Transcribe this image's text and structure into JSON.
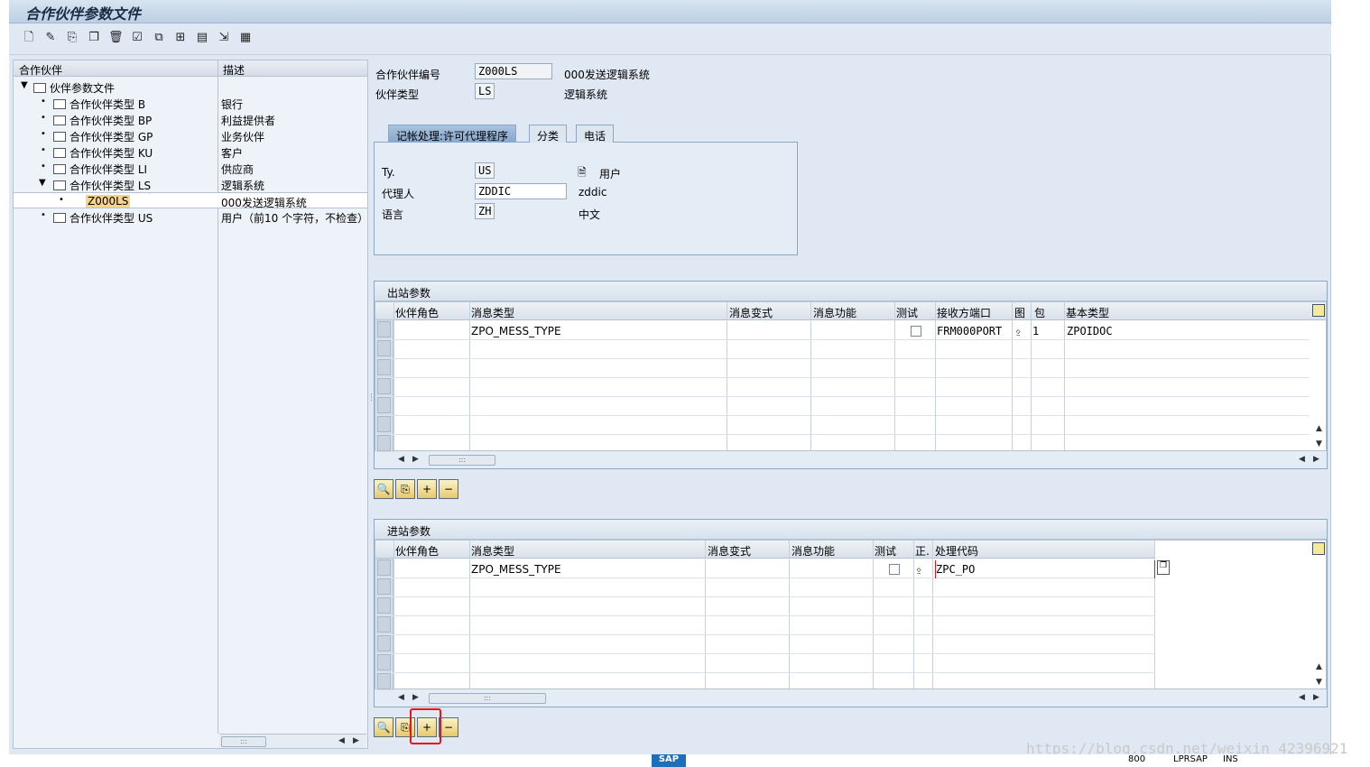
{
  "window": {
    "title": "合作伙伴参数文件"
  },
  "toolbar": {
    "icons": [
      "new-icon",
      "edit-icon",
      "copy-icon",
      "copy2-icon",
      "delete-icon",
      "check-icon",
      "other-icon",
      "hierarchy-icon",
      "print-icon",
      "import-icon",
      "export-icon"
    ]
  },
  "tree": {
    "col_partner": "合作伙伴",
    "col_desc": "描述",
    "root": "伙伴参数文件",
    "items": [
      {
        "name": "合作伙伴类型 B",
        "desc": "银行"
      },
      {
        "name": "合作伙伴类型 BP",
        "desc": "利益提供者"
      },
      {
        "name": "合作伙伴类型 GP",
        "desc": "业务伙伴"
      },
      {
        "name": "合作伙伴类型 KU",
        "desc": "客户"
      },
      {
        "name": "合作伙伴类型 LI",
        "desc": "供应商"
      },
      {
        "name": "合作伙伴类型 LS",
        "desc": "逻辑系统"
      },
      {
        "name": "Z000LS",
        "desc": "000发送逻辑系统"
      },
      {
        "name": "合作伙伴类型 US",
        "desc": "用户（前10 个字符，不检查）"
      }
    ]
  },
  "header": {
    "partner_no_label": "合作伙伴编号",
    "partner_no": "Z000LS",
    "partner_no_desc": "000发送逻辑系统",
    "partner_type_label": "伙伴类型",
    "partner_type": "LS",
    "partner_type_desc": "逻辑系统"
  },
  "tabs": {
    "t1": "记帐处理:许可代理程序",
    "t2": "分类",
    "t3": "电话",
    "ty_label": "Ty.",
    "ty_value": "US",
    "ty_desc": "用户",
    "agent_label": "代理人",
    "agent_value": "ZDDIC",
    "agent_desc": "zddic",
    "lang_label": "语言",
    "lang_value": "ZH",
    "lang_desc": "中文"
  },
  "outbound": {
    "title": "出站参数",
    "cols": [
      "伙伴角色",
      "消息类型",
      "消息变式",
      "消息功能",
      "测试",
      "接收方端口",
      "图",
      "包",
      "基本类型"
    ],
    "row": {
      "msg_type": "ZPO_MESS_TYPE",
      "port": "FRM000PORT",
      "pack": "1",
      "basic_type": "ZPOIDOC"
    }
  },
  "inbound": {
    "title": "进站参数",
    "cols": [
      "伙伴角色",
      "消息类型",
      "消息变式",
      "消息功能",
      "测试",
      "正.",
      "处理代码"
    ],
    "row": {
      "msg_type": "ZPO_MESS_TYPE",
      "proc_code": "ZPC_PO"
    }
  },
  "watermark": "https://blog.csdn.net/weixin_42396921",
  "status": {
    "client": "800",
    "server": "LPRSAP",
    "mode": "INS"
  }
}
